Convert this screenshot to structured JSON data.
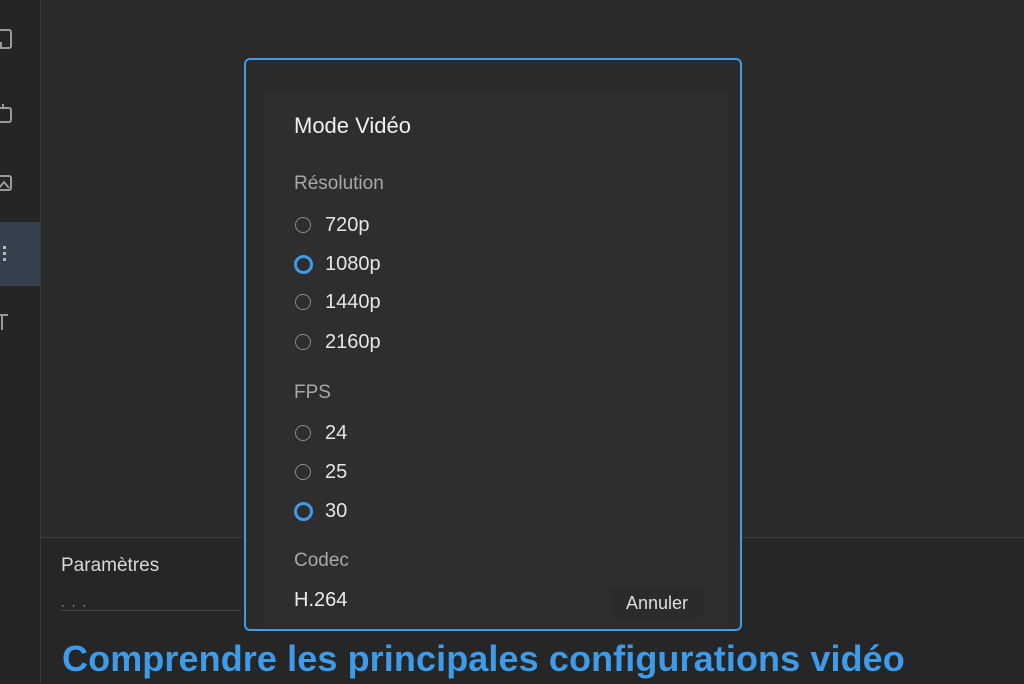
{
  "sidebar": {
    "icons": [
      "document-icon",
      "copy-icon",
      "image-icon",
      "grid-icon",
      "text-icon"
    ],
    "active_index": 3
  },
  "bottom_panel": {
    "title": "Paramètres",
    "dots": "· · ·"
  },
  "dialog": {
    "title": "Mode Vidéo",
    "resolution": {
      "label": "Résolution",
      "options": [
        "720p",
        "1080p",
        "1440p",
        "2160p"
      ],
      "selected": "1080p"
    },
    "fps": {
      "label": "FPS",
      "options": [
        "24",
        "25",
        "30"
      ],
      "selected": "30"
    },
    "codec": {
      "label": "Codec",
      "value": "H.264"
    },
    "cancel_label": "Annuler"
  },
  "headline": "Comprendre les principales configurations vidéo",
  "colors": {
    "accent": "#3d9be9",
    "background": "#262626",
    "dialog": "#2e2e2e"
  }
}
